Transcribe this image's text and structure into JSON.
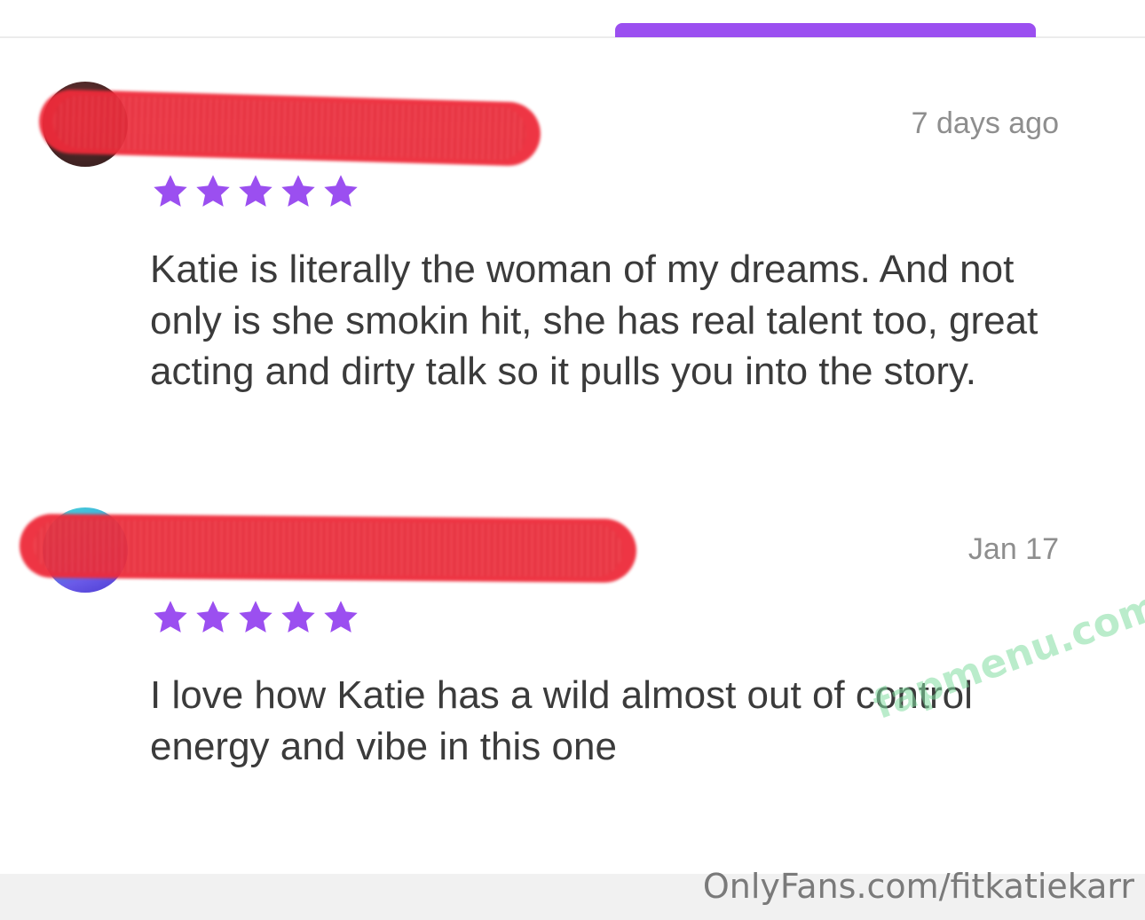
{
  "colors": {
    "accent": "#9b4ff0",
    "star": "#9b4ff0",
    "redaction": "#ee2b3a",
    "text": "#3b3b3b",
    "timestamp": "#8e8e8e"
  },
  "reviews": [
    {
      "timestamp": "7 days ago",
      "rating": 5,
      "text": "Katie is literally the woman of my dreams. And not only is she smokin hit, she has real talent too, great acting and dirty talk so it pulls you into the story."
    },
    {
      "timestamp": "Jan 17",
      "rating": 5,
      "text": "I love how Katie has a wild almost out of control energy and vibe in this one"
    }
  ],
  "watermarks": {
    "site": "fapmenu.com",
    "source": "OnlyFans.com/fitkatiekarr"
  },
  "icons": {
    "star": "star-icon"
  }
}
